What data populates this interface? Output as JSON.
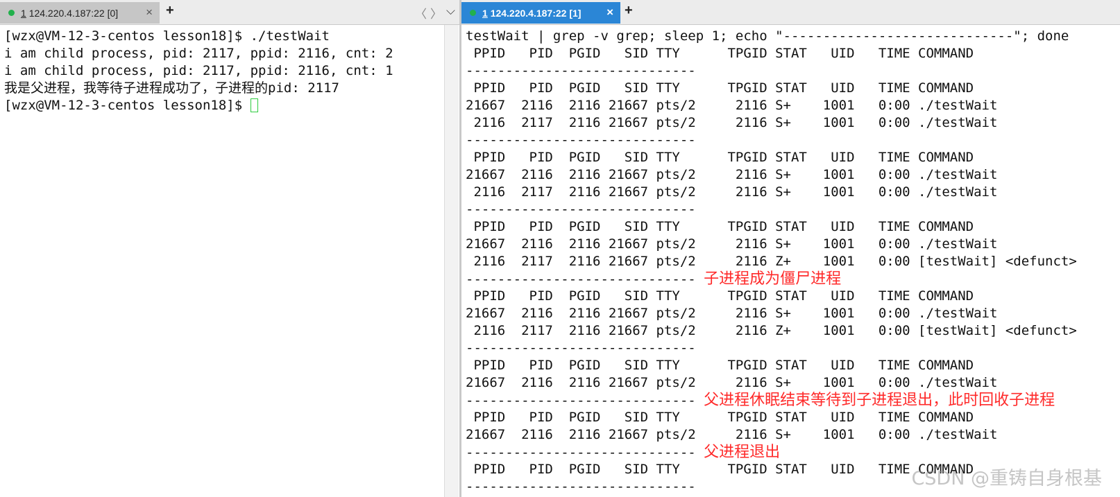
{
  "left_pane": {
    "tab": {
      "number": "1",
      "title": "124.220.4.187:22 [0]",
      "close": "×"
    },
    "new_tab": "+",
    "nav": {
      "prev": "〈",
      "next": "〉",
      "menu": "⌵"
    },
    "lines": [
      {
        "text": "[wzx@VM-12-3-centos lesson18]$ ./testWait",
        "cursor": false
      },
      {
        "text": "i am child process, pid: 2117, ppid: 2116, cnt: 2",
        "cursor": false
      },
      {
        "text": "i am child process, pid: 2117, ppid: 2116, cnt: 1",
        "cursor": false
      },
      {
        "text": "我是父进程，我等待子进程成功了，子进程的pid: 2117",
        "cursor": false
      },
      {
        "text": "[wzx@VM-12-3-centos lesson18]$ ",
        "cursor": true
      }
    ]
  },
  "right_pane": {
    "tab": {
      "number": "1",
      "title": "124.220.4.187:22 [1]",
      "close": "×"
    },
    "new_tab": "+",
    "lines": [
      {
        "text": "testWait | grep -v grep; sleep 1; echo \"-----------------------------\"; done",
        "annotation": ""
      },
      {
        "text": " PPID   PID  PGID   SID TTY      TPGID STAT   UID   TIME COMMAND",
        "annotation": ""
      },
      {
        "text": "-----------------------------",
        "annotation": ""
      },
      {
        "text": " PPID   PID  PGID   SID TTY      TPGID STAT   UID   TIME COMMAND",
        "annotation": ""
      },
      {
        "text": "21667  2116  2116 21667 pts/2     2116 S+    1001   0:00 ./testWait",
        "annotation": ""
      },
      {
        "text": " 2116  2117  2116 21667 pts/2     2116 S+    1001   0:00 ./testWait",
        "annotation": ""
      },
      {
        "text": "-----------------------------",
        "annotation": ""
      },
      {
        "text": " PPID   PID  PGID   SID TTY      TPGID STAT   UID   TIME COMMAND",
        "annotation": ""
      },
      {
        "text": "21667  2116  2116 21667 pts/2     2116 S+    1001   0:00 ./testWait",
        "annotation": ""
      },
      {
        "text": " 2116  2117  2116 21667 pts/2     2116 S+    1001   0:00 ./testWait",
        "annotation": ""
      },
      {
        "text": "-----------------------------",
        "annotation": ""
      },
      {
        "text": " PPID   PID  PGID   SID TTY      TPGID STAT   UID   TIME COMMAND",
        "annotation": ""
      },
      {
        "text": "21667  2116  2116 21667 pts/2     2116 S+    1001   0:00 ./testWait",
        "annotation": ""
      },
      {
        "text": " 2116  2117  2116 21667 pts/2     2116 Z+    1001   0:00 [testWait] <defunct>",
        "annotation": ""
      },
      {
        "text": "----------------------------- ",
        "annotation": "子进程成为僵尸进程"
      },
      {
        "text": " PPID   PID  PGID   SID TTY      TPGID STAT   UID   TIME COMMAND",
        "annotation": ""
      },
      {
        "text": "21667  2116  2116 21667 pts/2     2116 S+    1001   0:00 ./testWait",
        "annotation": ""
      },
      {
        "text": " 2116  2117  2116 21667 pts/2     2116 Z+    1001   0:00 [testWait] <defunct>",
        "annotation": ""
      },
      {
        "text": "-----------------------------",
        "annotation": ""
      },
      {
        "text": " PPID   PID  PGID   SID TTY      TPGID STAT   UID   TIME COMMAND",
        "annotation": ""
      },
      {
        "text": "21667  2116  2116 21667 pts/2     2116 S+    1001   0:00 ./testWait",
        "annotation": ""
      },
      {
        "text": "----------------------------- ",
        "annotation": "父进程休眠结束等待到子进程退出，此时回收子进程"
      },
      {
        "text": " PPID   PID  PGID   SID TTY      TPGID STAT   UID   TIME COMMAND",
        "annotation": ""
      },
      {
        "text": "21667  2116  2116 21667 pts/2     2116 S+    1001   0:00 ./testWait",
        "annotation": ""
      },
      {
        "text": "----------------------------- ",
        "annotation": "父进程退出"
      },
      {
        "text": " PPID   PID  PGID   SID TTY      TPGID STAT   UID   TIME COMMAND",
        "annotation": ""
      },
      {
        "text": "-----------------------------",
        "annotation": ""
      }
    ]
  },
  "watermark": "CSDN @重铸自身根基",
  "colors": {
    "active_tab": "#2b86d6",
    "status_dot": "#22b14c",
    "annotation": "#ff2a2a",
    "cursor": "#2ecc40"
  }
}
